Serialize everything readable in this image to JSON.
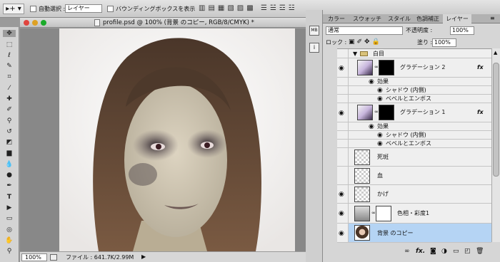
{
  "options_bar": {
    "auto_select_label": "自動選択 :",
    "auto_select_value": "レイヤー",
    "bounding_box_label": "バウンディングボックスを表示"
  },
  "document": {
    "title": "profile.psd @ 100% (背景 のコピー, RGB/8/CMYK) *",
    "zoom": "100%",
    "file_info": "ファイル : 641.7K/2.99M"
  },
  "panel": {
    "tabs": [
      "カラー",
      "スウォッチ",
      "スタイル",
      "色調補正",
      "レイヤー"
    ],
    "active_tab": "レイヤー",
    "blend_mode": "通常",
    "opacity_label": "不透明度 :",
    "opacity_value": "100%",
    "lock_label": "ロック :",
    "fill_label": "塗り :",
    "fill_value": "100%",
    "layers": {
      "group_name": "白目",
      "grad2": "グラデーション 2",
      "grad1": "グラデーション 1",
      "effects": "効果",
      "inner_shadow": "シャドウ (内側)",
      "bevel": "ベベルとエンボス",
      "spots": "死斑",
      "blood": "血",
      "shadow": "かげ",
      "hue_sat": "色相・彩度1",
      "bg_copy": "背景 のコピー"
    },
    "fx_symbol": "fx"
  },
  "colors": {
    "selected_row": "#b5d4f4",
    "accent": "#3b78d8"
  }
}
